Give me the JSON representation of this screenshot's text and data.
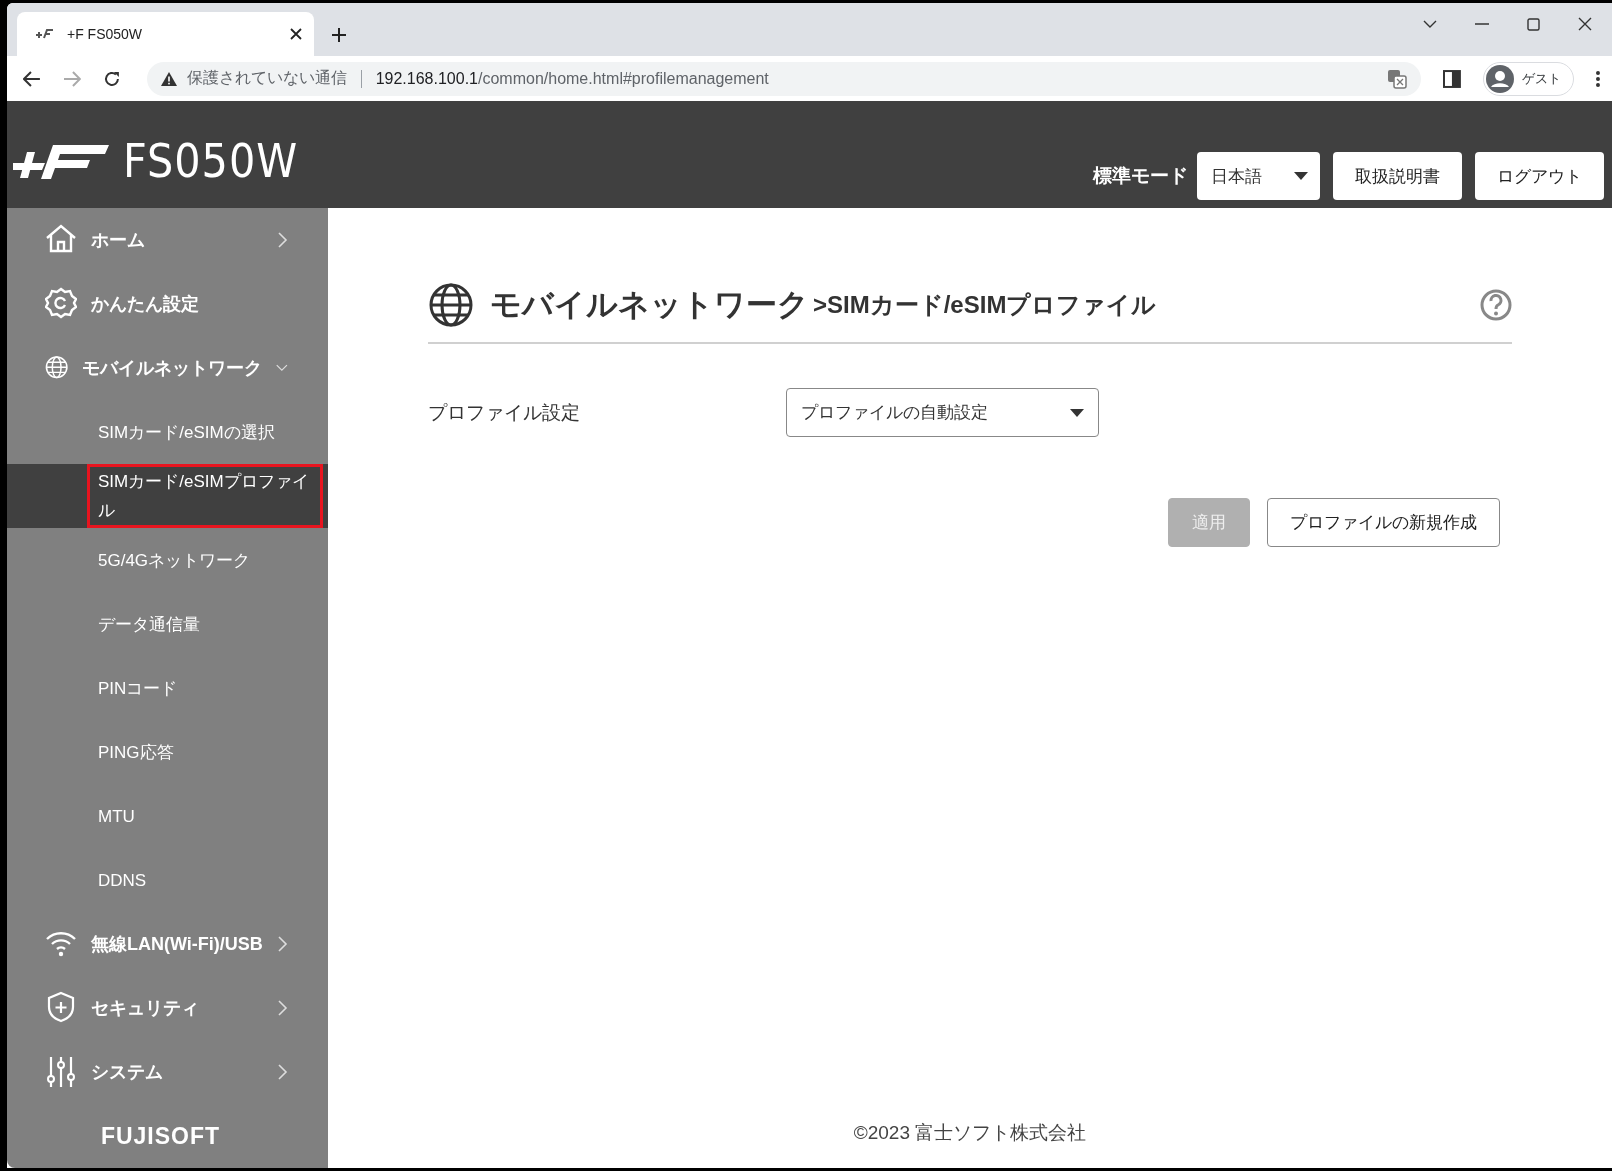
{
  "browser": {
    "tab": {
      "title": "+F FS050W"
    },
    "address": {
      "security": "保護されていない通信",
      "host": "192.168.100.1",
      "path": "/common/home.html#profilemanagement"
    },
    "profile": "ゲスト"
  },
  "header": {
    "product": "FS050W",
    "mode": "標準モード",
    "language": {
      "value": "日本語"
    },
    "buttons": [
      "取扱説明書",
      "ログアウト"
    ]
  },
  "sidebar": {
    "items": [
      {
        "label": "ホーム",
        "kind": "home",
        "expanded": false
      },
      {
        "label": "かんたん設定",
        "kind": "gear"
      },
      {
        "label": "モバイルネットワーク",
        "kind": "globe",
        "expanded": true,
        "children": [
          {
            "label": "SIMカード/eSIMの選択",
            "selected": false,
            "outlined": false
          },
          {
            "label": "SIMカード/eSIMプロファイル",
            "selected": true,
            "outlined": true
          },
          {
            "label": "5G/4Gネットワーク",
            "selected": false,
            "outlined": false
          },
          {
            "label": "データ通信量",
            "selected": false,
            "outlined": false
          },
          {
            "label": "PINコード",
            "selected": false,
            "outlined": false
          },
          {
            "label": "PING応答",
            "selected": false,
            "outlined": false
          },
          {
            "label": "MTU",
            "selected": false,
            "outlined": false
          },
          {
            "label": "DDNS",
            "selected": false,
            "outlined": false
          }
        ]
      },
      {
        "label": "無線LAN(Wi-Fi)/USB",
        "kind": "wifi",
        "expanded": false
      },
      {
        "label": "セキュリティ",
        "kind": "shield",
        "expanded": false
      },
      {
        "label": "システム",
        "kind": "sliders",
        "expanded": false
      }
    ],
    "brand": "FUJISOFT"
  },
  "content": {
    "title": {
      "section": "モバイルネットワーク",
      "page": ">SIMカード/eSIMプロファイル"
    },
    "fields": [
      {
        "label": "プロファイル設定",
        "value": "プロファイルの自動設定"
      }
    ],
    "buttons": [
      {
        "label": "適用",
        "disabled": true
      },
      {
        "label": "プロファイルの新規作成",
        "disabled": false
      }
    ],
    "footer": "©2023 富士ソフト株式会社"
  }
}
